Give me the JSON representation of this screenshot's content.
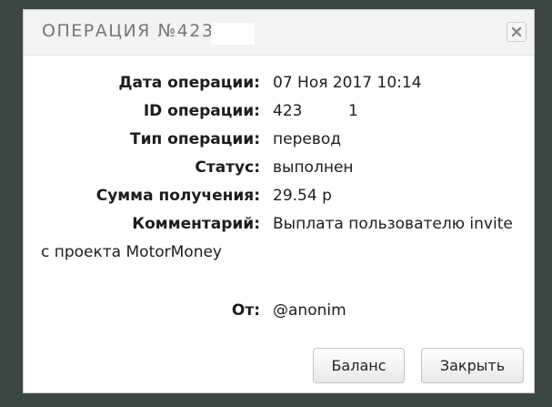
{
  "modal": {
    "title": "ОПЕРАЦИЯ №4231",
    "close_symbol": "×"
  },
  "details": [
    {
      "label": "Дата операции:",
      "value": "07 Ноя 2017 10:14"
    },
    {
      "label": "ID операции:",
      "value": "423"
    },
    {
      "label": "Тип операции:",
      "value": "перевод"
    },
    {
      "label": "Статус:",
      "value": "выполнен"
    },
    {
      "label": "Сумма получения:",
      "value": "29.54 р"
    },
    {
      "label": "Комментарий:",
      "value": "Выплата пользователю invite"
    }
  ],
  "id_tail": "1",
  "comment_continuation": "с проекта MotorMoney",
  "from": {
    "label": "От:",
    "value": "@anonim"
  },
  "buttons": {
    "balance": "Баланс",
    "close": "Закрыть"
  }
}
